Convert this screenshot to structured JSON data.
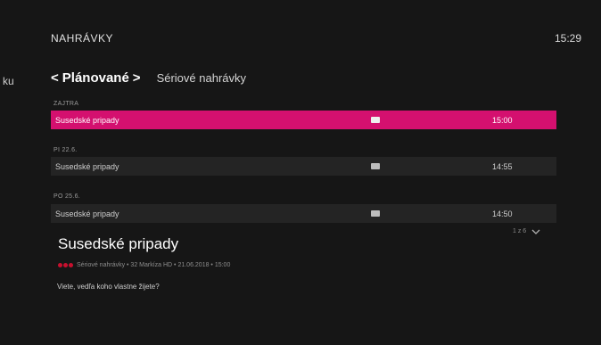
{
  "header": {
    "section_title": "NAHRÁVKY",
    "clock": "15:29",
    "left_tab_partial": "ku"
  },
  "tabs": {
    "active_label": "Plánované",
    "active_prev_glyph": "<",
    "active_next_glyph": ">",
    "other_label": "Sériové nahrávky"
  },
  "recordings": [
    {
      "day": "ZAJTRA",
      "title": "Susedské pripady",
      "badge": "hd-icon",
      "time": "15:00",
      "selected": true
    },
    {
      "day": "PI 22.6.",
      "title": "Susedské pripady",
      "badge": "hd-icon",
      "time": "14:55",
      "selected": false
    },
    {
      "day": "PO 25.6.",
      "title": "Susedské pripady",
      "badge": "hd-icon",
      "time": "14:50",
      "selected": false
    }
  ],
  "pager": {
    "text": "1 z 6",
    "icon": "chevron-down-icon"
  },
  "detail": {
    "title": "Susedské pripady",
    "meta": "Sériové nahrávky • 32 Markíza HD • 21.06.2018 • 15:00",
    "meta_icon": "series-dots-icon",
    "description": "Viete, vedľa koho vlastne žijete?"
  },
  "colors": {
    "background": "#161616",
    "row_bg": "#242424",
    "accent": "#d4106f",
    "series_dots": "#c8102e"
  }
}
